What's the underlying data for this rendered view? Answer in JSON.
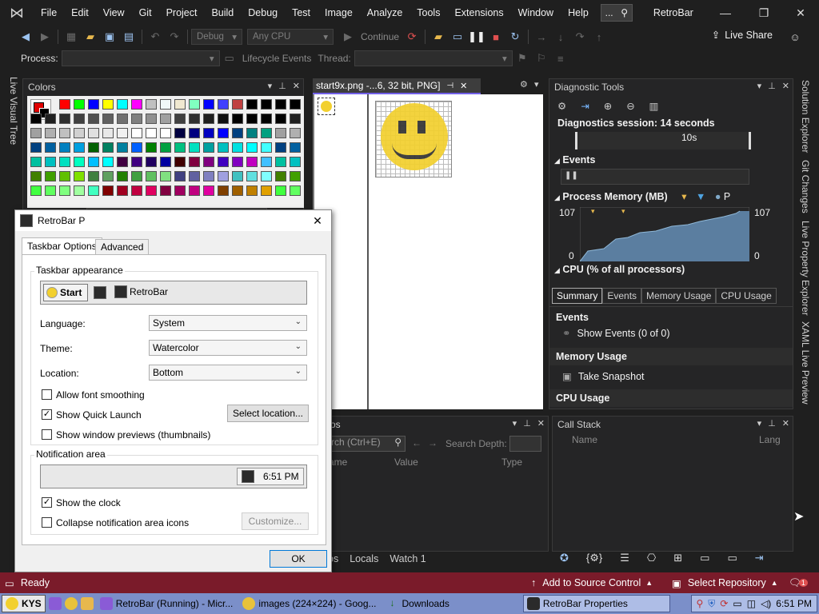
{
  "menu": {
    "items": [
      "File",
      "Edit",
      "View",
      "Git",
      "Project",
      "Build",
      "Debug",
      "Test",
      "Image",
      "Analyze",
      "Tools",
      "Extensions",
      "Window",
      "Help"
    ],
    "search_text": "...",
    "solution_name": "RetroBar"
  },
  "toolbar": {
    "config": "Debug",
    "platform": "Any CPU",
    "continue_label": "Continue",
    "live_share": "Live Share",
    "process_label": "Process:",
    "lifecycle_label": "Lifecycle Events",
    "thread_label": "Thread:"
  },
  "side_tabs": {
    "left": "Live Visual Tree",
    "right": [
      "Solution Explorer",
      "Git Changes",
      "Live Property Explorer",
      "XAML Live Preview"
    ]
  },
  "colors_panel": {
    "title": "Colors"
  },
  "editor": {
    "tab_title": "start9x.png -...6, 32 bit, PNG]"
  },
  "diagnostics": {
    "title": "Diagnostic Tools",
    "session": "Diagnostics session: 14 seconds",
    "timeline_label": "10s",
    "events_label": "Events",
    "memory_label": "Process Memory (MB)",
    "memory_p": "P",
    "mem_max_left": "107",
    "mem_max_right": "107",
    "mem_min_left": "0",
    "mem_min_right": "0",
    "cpu_label": "CPU (% of all processors)",
    "tabs": [
      "Summary",
      "Events",
      "Memory Usage",
      "CPU Usage"
    ],
    "sections": {
      "events": "Events",
      "show_events": "Show Events (0 of 0)",
      "memory": "Memory Usage",
      "snapshot": "Take Snapshot",
      "cpu": "CPU Usage"
    }
  },
  "locals": {
    "search_placeholder": "rch (Ctrl+E)",
    "depth_label": "Search Depth:",
    "cols": [
      "ame",
      "Value",
      "Type"
    ],
    "bottom_tabs": [
      "os",
      "Locals",
      "Watch 1"
    ]
  },
  "callstack": {
    "title": "Call Stack",
    "cols": [
      "Name",
      "Lang"
    ]
  },
  "debug_toolbar": {
    "badge": "4"
  },
  "dialog": {
    "title": "RetroBar P",
    "tabs": [
      "Taskbar Options",
      "Advanced"
    ],
    "appearance_group": "Taskbar appearance",
    "preview_start": "Start",
    "preview_app": "RetroBar",
    "language_label": "Language:",
    "language_value": "System",
    "theme_label": "Theme:",
    "theme_value": "Watercolor",
    "location_label": "Location:",
    "location_value": "Bottom",
    "font_smoothing": "Allow font smoothing",
    "quick_launch": "Show Quick Launch",
    "select_location": "Select location...",
    "window_previews": "Show window previews (thumbnails)",
    "notification_group": "Notification area",
    "clock_preview": "6:51 PM",
    "show_clock": "Show the clock",
    "collapse_icons": "Collapse notification area icons",
    "customize": "Customize...",
    "ok": "OK"
  },
  "statusbar": {
    "ready": "Ready",
    "source_control": "Add to Source Control",
    "select_repo": "Select Repository",
    "notif_count": "1"
  },
  "taskbar": {
    "start": "KYS",
    "items": [
      "RetroBar (Running) - Micr...",
      "images (224×224) - Goog...",
      "Downloads",
      "RetroBar Properties"
    ],
    "clock": "6:51 PM"
  }
}
